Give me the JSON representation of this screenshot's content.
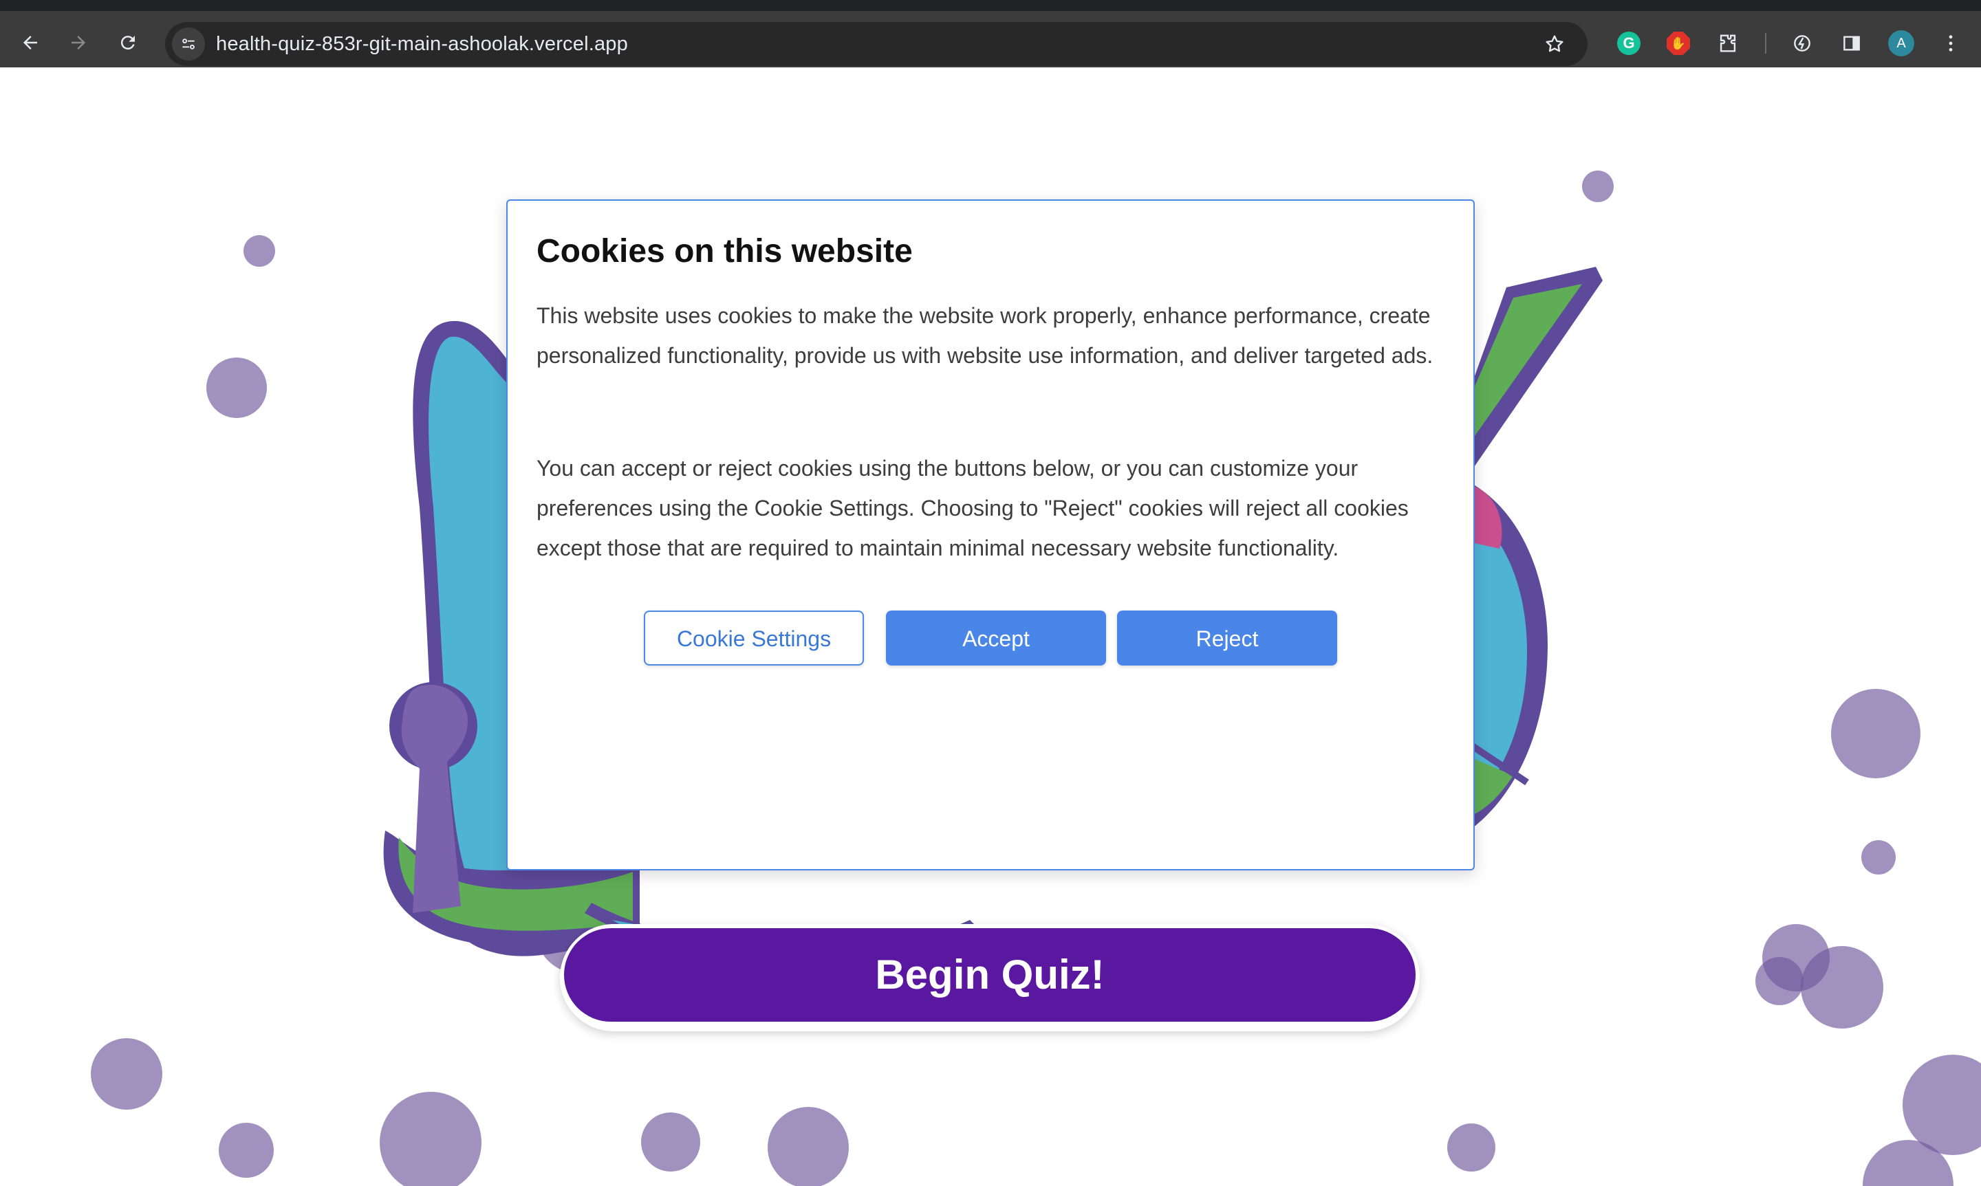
{
  "browser": {
    "url": "health-quiz-853r-git-main-ashoolak.vercel.app",
    "profile_initial": "A",
    "icons": {
      "back": "back-arrow-icon",
      "forward": "forward-arrow-icon",
      "reload": "reload-icon",
      "site_info": "site-info-icon",
      "bookmark": "star-icon",
      "grammarly": "grammarly-icon",
      "adblock": "adblock-icon",
      "extensions": "puzzle-icon",
      "performance": "performance-icon",
      "side_panel": "side-panel-icon",
      "menu": "kebab-menu-icon"
    },
    "grammarly_letter": "G"
  },
  "cookie_modal": {
    "title": "Cookies on this website",
    "paragraph_1": "This website uses cookies to make the website work properly, enhance performance, create personalized functionality, provide us with website use information, and deliver targeted ads.",
    "paragraph_2": "You can accept or reject cookies using the buttons below, or you can customize your preferences using the Cookie Settings. Choosing to \"Reject\" cookies will reject all cookies except those that are required to maintain minimal necessary website functionality.",
    "buttons": {
      "settings": "Cookie Settings",
      "accept": "Accept",
      "reject": "Reject"
    }
  },
  "main": {
    "begin_button": "Begin Quiz!"
  },
  "colors": {
    "accent_blue": "#4a86e8",
    "quiz_purple": "#5a17a0",
    "bubble_purple": "#70589c",
    "logo_outline": "#5e4a9a",
    "logo_blue": "#4fb3d4",
    "logo_green": "#5fad56",
    "logo_pink": "#c94f8f",
    "logo_orange": "#e8843a"
  }
}
